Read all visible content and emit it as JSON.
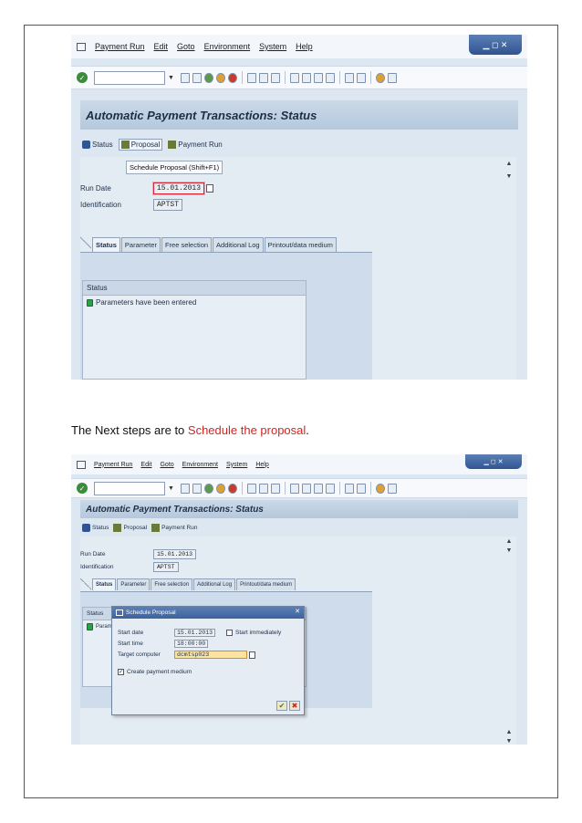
{
  "menu": {
    "items": [
      "Payment Run",
      "Edit",
      "Goto",
      "Environment",
      "System",
      "Help"
    ]
  },
  "window_controls": "▁ ◻ ✕",
  "screen1": {
    "title": "Automatic Payment Transactions: Status",
    "app_toolbar": {
      "status": "Status",
      "proposal": "Proposal",
      "payment_run": "Payment Run"
    },
    "tooltip": "Schedule Proposal   (Shift+F1)",
    "run_date_label": "Run Date",
    "run_date_value": "15.01.2013",
    "identification_label": "Identification",
    "identification_value": "APTST",
    "tabs": [
      "Status",
      "Parameter",
      "Free selection",
      "Additional Log",
      "Printout/data medium"
    ],
    "status_header": "Status",
    "status_message": "Parameters have been entered"
  },
  "between_text": {
    "prefix": "The Next steps are to ",
    "highlight": "Schedule the proposal",
    "suffix": "."
  },
  "screen2": {
    "title": "Automatic Payment Transactions: Status",
    "app_toolbar": {
      "status": "Status",
      "proposal": "Proposal",
      "payment_run": "Payment Run"
    },
    "run_date_label": "Run Date",
    "run_date_value": "15.01.2013",
    "identification_label": "Identification",
    "identification_value": "APTST",
    "tabs": [
      "Status",
      "Parameter",
      "Free selection",
      "Additional Log",
      "Printout/data medium"
    ],
    "status_header": "Status",
    "status_message_partial": "Param",
    "dialog": {
      "title": "Schedule Proposal",
      "start_date_label": "Start date",
      "start_date_value": "15.01.2013",
      "start_immediately_label": "Start immediately",
      "start_time_label": "Start time",
      "start_time_value": "18:00:00",
      "target_computer_label": "Target computer",
      "target_computer_value": "dcmtsp023",
      "create_payment_medium_label": "Create payment medium"
    }
  },
  "colors": {
    "highlight_red": "#d12424",
    "sap_blue": "#2f5491"
  }
}
